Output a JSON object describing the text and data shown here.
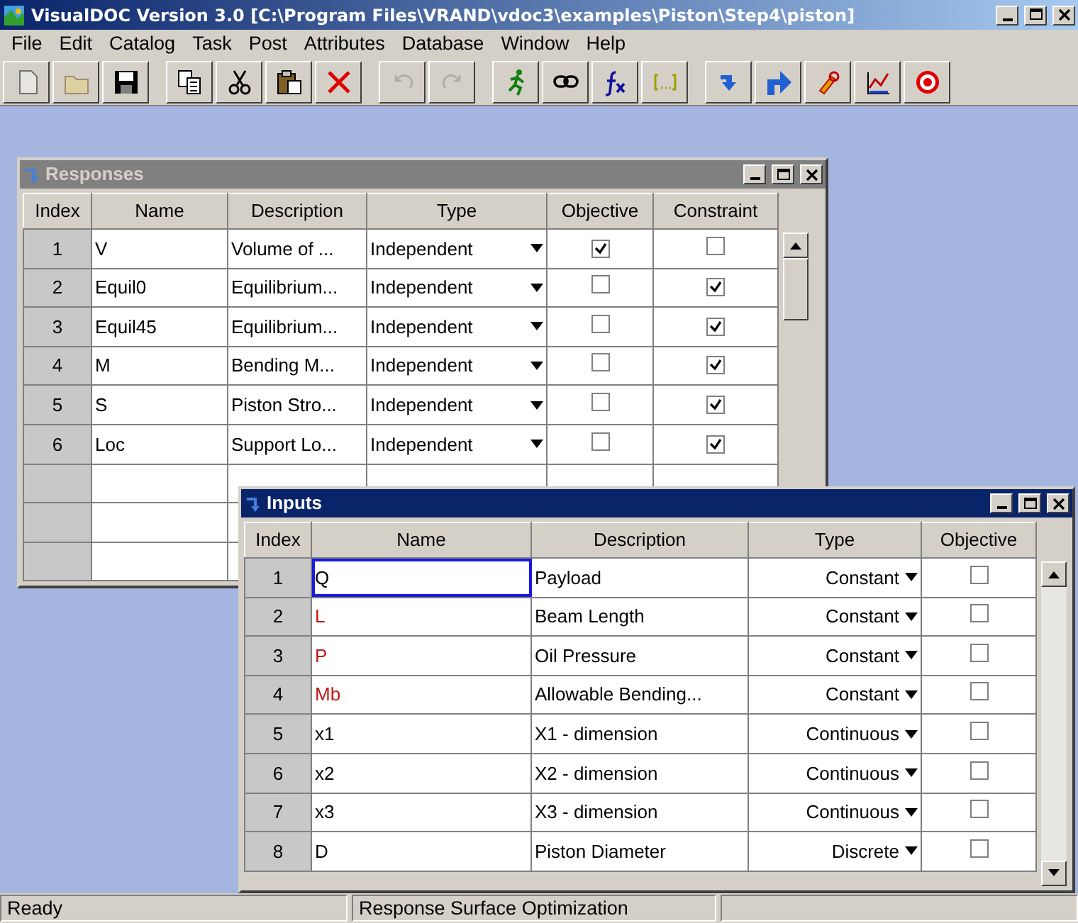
{
  "window": {
    "title": "VisualDOC Version 3.0  [C:\\Program Files\\VRAND\\vdoc3\\examples\\Piston\\Step4\\piston]"
  },
  "menu": [
    "File",
    "Edit",
    "Catalog",
    "Task",
    "Post",
    "Attributes",
    "Database",
    "Window",
    "Help"
  ],
  "toolbar": [
    [
      {
        "kind": "new",
        "disabled": true
      },
      {
        "kind": "open",
        "disabled": true
      },
      {
        "kind": "save",
        "disabled": false
      }
    ],
    [
      {
        "kind": "copy",
        "disabled": false
      },
      {
        "kind": "cut",
        "disabled": false
      },
      {
        "kind": "paste",
        "disabled": false
      },
      {
        "kind": "delete",
        "disabled": false
      }
    ],
    [
      {
        "kind": "undo",
        "disabled": true
      },
      {
        "kind": "redo",
        "disabled": true
      }
    ],
    [
      {
        "kind": "run",
        "disabled": false
      },
      {
        "kind": "link",
        "disabled": false
      },
      {
        "kind": "function",
        "disabled": false
      },
      {
        "kind": "bracket",
        "disabled": false
      }
    ],
    [
      {
        "kind": "down",
        "disabled": false
      },
      {
        "kind": "up",
        "disabled": false
      },
      {
        "kind": "tool",
        "disabled": false
      },
      {
        "kind": "chart",
        "disabled": false
      },
      {
        "kind": "target",
        "disabled": false
      }
    ]
  ],
  "responses": {
    "title": "Responses",
    "active": false,
    "columns": [
      "Index",
      "Name",
      "Description",
      "Type",
      "Objective",
      "Constraint"
    ],
    "rows": [
      {
        "index": "1",
        "name": "V",
        "description": "Volume of ...",
        "type": "Independent",
        "objective": true,
        "constraint": false
      },
      {
        "index": "2",
        "name": "Equil0",
        "description": "Equilibrium...",
        "type": "Independent",
        "objective": false,
        "constraint": true
      },
      {
        "index": "3",
        "name": "Equil45",
        "description": "Equilibrium...",
        "type": "Independent",
        "objective": false,
        "constraint": true
      },
      {
        "index": "4",
        "name": "M",
        "description": "Bending M...",
        "type": "Independent",
        "objective": false,
        "constraint": true
      },
      {
        "index": "5",
        "name": "S",
        "description": "Piston Stro...",
        "type": "Independent",
        "objective": false,
        "constraint": true
      },
      {
        "index": "6",
        "name": "Loc",
        "description": "Support Lo...",
        "type": "Independent",
        "objective": false,
        "constraint": true
      }
    ]
  },
  "inputs": {
    "title": "Inputs",
    "active": true,
    "columns": [
      "Index",
      "Name",
      "Description",
      "Type",
      "Objective"
    ],
    "rows": [
      {
        "index": "1",
        "name": "Q",
        "color": "#000000",
        "focused": true,
        "description": "Payload",
        "type": "Constant",
        "objective": false
      },
      {
        "index": "2",
        "name": "L",
        "color": "#c01818",
        "focused": false,
        "description": "Beam Length",
        "type": "Constant",
        "objective": false
      },
      {
        "index": "3",
        "name": "P",
        "color": "#c01818",
        "focused": false,
        "description": "Oil Pressure",
        "type": "Constant",
        "objective": false
      },
      {
        "index": "4",
        "name": "Mb",
        "color": "#c01818",
        "focused": false,
        "description": "Allowable Bending...",
        "type": "Constant",
        "objective": false
      },
      {
        "index": "5",
        "name": "x1",
        "color": "#000000",
        "focused": false,
        "description": "X1 - dimension",
        "type": "Continuous",
        "objective": false
      },
      {
        "index": "6",
        "name": "x2",
        "color": "#000000",
        "focused": false,
        "description": "X2 - dimension",
        "type": "Continuous",
        "objective": false
      },
      {
        "index": "7",
        "name": "x3",
        "color": "#000000",
        "focused": false,
        "description": "X3 - dimension",
        "type": "Continuous",
        "objective": false
      },
      {
        "index": "8",
        "name": "D",
        "color": "#000000",
        "focused": false,
        "description": "Piston Diameter",
        "type": "Discrete",
        "objective": false
      }
    ]
  },
  "status_bar": [
    "Ready",
    "Response Surface Optimization"
  ]
}
